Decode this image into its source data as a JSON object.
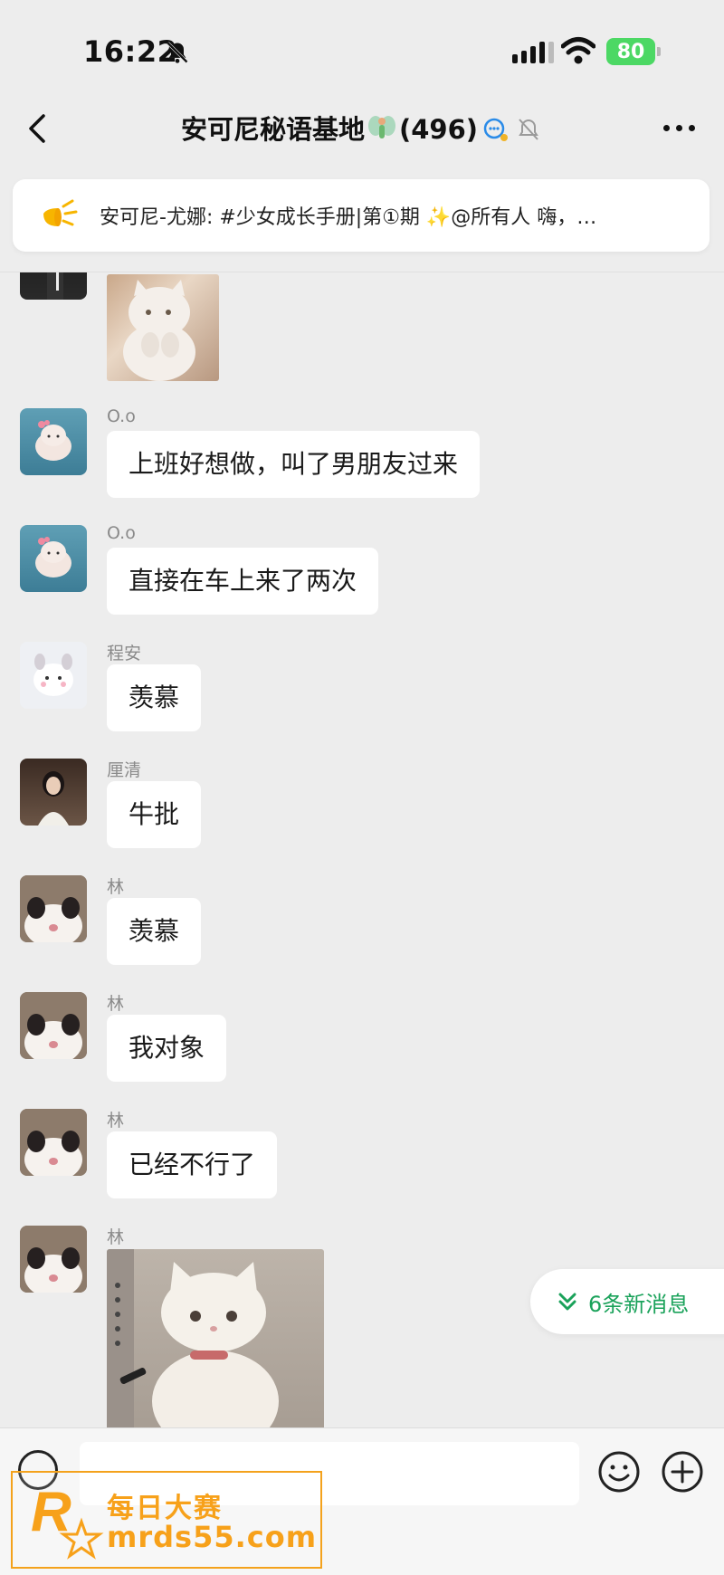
{
  "status_bar": {
    "time": "16:22",
    "battery": "80"
  },
  "header": {
    "back_icon": "chevron-left-icon",
    "title": "安可尼秘语基地",
    "count": "(496)",
    "more_icon": "more-dots-icon"
  },
  "notice": {
    "text": "安可尼-尤娜: #少女成长手册|第①期 ✨@所有人  嗨，…"
  },
  "messages": [
    {
      "sender": "O.o",
      "text": "上班好想做，叫了男朋友过来"
    },
    {
      "sender": "O.o",
      "text": "直接在车上来了两次"
    },
    {
      "sender": "程安",
      "text": "羡慕"
    },
    {
      "sender": "厘清",
      "text": "牛批"
    },
    {
      "sender": "林",
      "text": "羡慕"
    },
    {
      "sender": "林",
      "text": "我对象"
    },
    {
      "sender": "林",
      "text": "已经不行了"
    },
    {
      "sender": "林",
      "text": ""
    }
  ],
  "new_messages": {
    "label": "6条新消息"
  },
  "watermark": {
    "top": "每日大赛",
    "bottom": "mrds55.com",
    "logo_letter": "R"
  },
  "colors": {
    "background": "#ededed",
    "accent_green": "#1aa25a",
    "battery_green": "#4cd864",
    "watermark_orange": "#f7a11a"
  }
}
